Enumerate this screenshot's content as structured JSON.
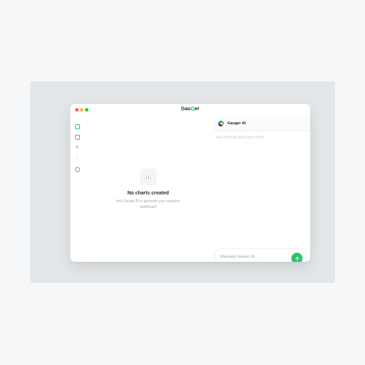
{
  "window": {
    "title_prefix": "Gau",
    "title_suffix": "er"
  },
  "sidebar": {
    "items": [
      {
        "icon": "chart-icon"
      },
      {
        "icon": "document-icon"
      },
      {
        "icon": "text-icon",
        "glyph": "A"
      },
      {
        "icon": "bar-chart-icon",
        "glyph": "⫶"
      },
      {
        "icon": "settings-icon"
      }
    ]
  },
  "empty_state": {
    "title": "No charts created",
    "description": "Ask Gauger AI to generate your analytics dashboard"
  },
  "chat": {
    "assistant_name": "Gauger AI",
    "prompt_hint": "Ask anything about your charts",
    "input_placeholder": "Message Gauger AI..."
  },
  "colors": {
    "accent": "#2bc46f",
    "close": "#ff5f57",
    "minimize": "#febc2e",
    "maximize": "#28c840"
  }
}
